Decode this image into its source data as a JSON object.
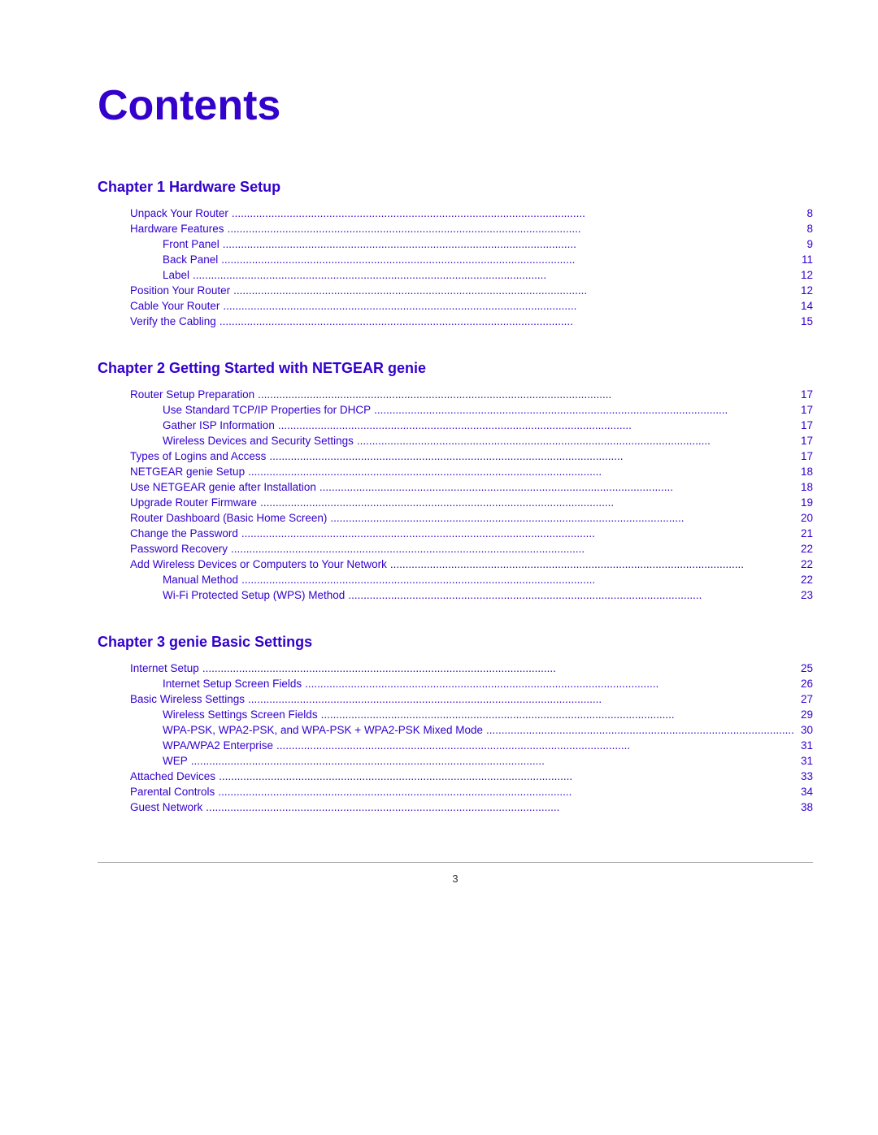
{
  "page": {
    "title": "Contents",
    "page_number": "3"
  },
  "chapters": [
    {
      "id": "chapter1",
      "heading": "Chapter 1    Hardware Setup",
      "entries": [
        {
          "level": 1,
          "title": "Unpack Your Router",
          "dots": true,
          "page": "8"
        },
        {
          "level": 1,
          "title": "Hardware Features",
          "dots": true,
          "page": "8"
        },
        {
          "level": 2,
          "title": "Front Panel",
          "dots": true,
          "page": "9"
        },
        {
          "level": 2,
          "title": "Back Panel",
          "dots": true,
          "page": "11"
        },
        {
          "level": 2,
          "title": "Label",
          "dots": true,
          "page": "12"
        },
        {
          "level": 1,
          "title": "Position Your Router",
          "dots": true,
          "page": "12"
        },
        {
          "level": 1,
          "title": "Cable Your Router",
          "dots": true,
          "page": "14"
        },
        {
          "level": 1,
          "title": "Verify the Cabling",
          "dots": true,
          "page": "15"
        }
      ]
    },
    {
      "id": "chapter2",
      "heading": "Chapter 2    Getting Started with NETGEAR genie",
      "entries": [
        {
          "level": 1,
          "title": "Router Setup Preparation",
          "dots": true,
          "page": "17"
        },
        {
          "level": 2,
          "title": "Use Standard TCP/IP Properties for DHCP",
          "dots": true,
          "page": "17"
        },
        {
          "level": 2,
          "title": "Gather ISP Information",
          "dots": true,
          "page": "17"
        },
        {
          "level": 2,
          "title": "Wireless Devices and Security Settings",
          "dots": true,
          "page": "17"
        },
        {
          "level": 1,
          "title": "Types of Logins and Access",
          "dots": true,
          "page": "17"
        },
        {
          "level": 1,
          "title": "NETGEAR genie Setup",
          "dots": true,
          "page": "18"
        },
        {
          "level": 1,
          "title": "Use NETGEAR genie after Installation",
          "dots": true,
          "page": "18"
        },
        {
          "level": 1,
          "title": "Upgrade Router Firmware",
          "dots": true,
          "page": "19"
        },
        {
          "level": 1,
          "title": "Router Dashboard (Basic Home Screen)",
          "dots": true,
          "page": "20"
        },
        {
          "level": 1,
          "title": "Change the Password",
          "dots": true,
          "page": "21"
        },
        {
          "level": 1,
          "title": "Password Recovery",
          "dots": true,
          "page": "22"
        },
        {
          "level": 1,
          "title": "Add Wireless Devices or Computers to Your Network",
          "dots": true,
          "page": "22"
        },
        {
          "level": 2,
          "title": "Manual Method",
          "dots": true,
          "page": "22"
        },
        {
          "level": 2,
          "title": "Wi-Fi Protected Setup (WPS) Method",
          "dots": true,
          "page": "23"
        }
      ]
    },
    {
      "id": "chapter3",
      "heading": "Chapter 3    genie Basic Settings",
      "entries": [
        {
          "level": 1,
          "title": "Internet Setup",
          "dots": true,
          "page": "25"
        },
        {
          "level": 2,
          "title": "Internet Setup Screen Fields",
          "dots": true,
          "page": "26"
        },
        {
          "level": 1,
          "title": "Basic Wireless Settings",
          "dots": true,
          "page": "27"
        },
        {
          "level": 2,
          "title": "Wireless Settings Screen Fields",
          "dots": true,
          "page": "29"
        },
        {
          "level": 2,
          "title": "WPA-PSK, WPA2-PSK, and WPA-PSK + WPA2-PSK Mixed Mode",
          "dots": true,
          "page": "30"
        },
        {
          "level": 2,
          "title": "WPA/WPA2 Enterprise",
          "dots": true,
          "page": "31"
        },
        {
          "level": 2,
          "title": "WEP",
          "dots": true,
          "page": "31"
        },
        {
          "level": 1,
          "title": "Attached Devices",
          "dots": true,
          "page": "33"
        },
        {
          "level": 1,
          "title": "Parental Controls",
          "dots": true,
          "page": "34"
        },
        {
          "level": 1,
          "title": "Guest Network",
          "dots": true,
          "page": "38"
        }
      ]
    }
  ]
}
